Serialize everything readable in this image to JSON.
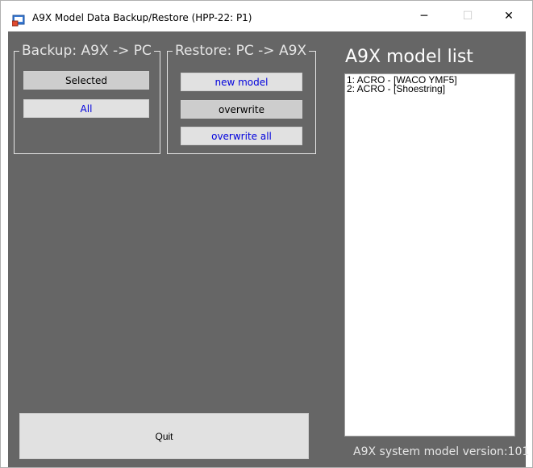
{
  "window": {
    "title": "A9X Model Data Backup/Restore (HPP-22: P1)",
    "minimize_glyph": "─",
    "maximize_glyph": "☐",
    "close_glyph": "✕"
  },
  "backup": {
    "caption": "Backup: A9X -> PC",
    "selected_label": "Selected",
    "all_label": "All"
  },
  "restore": {
    "caption": "Restore: PC -> A9X",
    "new_model_label": "new model",
    "overwrite_label": "overwrite",
    "overwrite_all_label": "overwrite all"
  },
  "model_list": {
    "title": "A9X model list",
    "items": [
      "1:  ACRO - [WACO YMF5]",
      "2:  ACRO - [Shoestring]"
    ]
  },
  "quit_label": "Quit",
  "version_text": "A9X system model version:101",
  "colors": {
    "client_bg": "#666666",
    "button_bg": "#e1e1e1",
    "link_blue": "#0000dd"
  }
}
